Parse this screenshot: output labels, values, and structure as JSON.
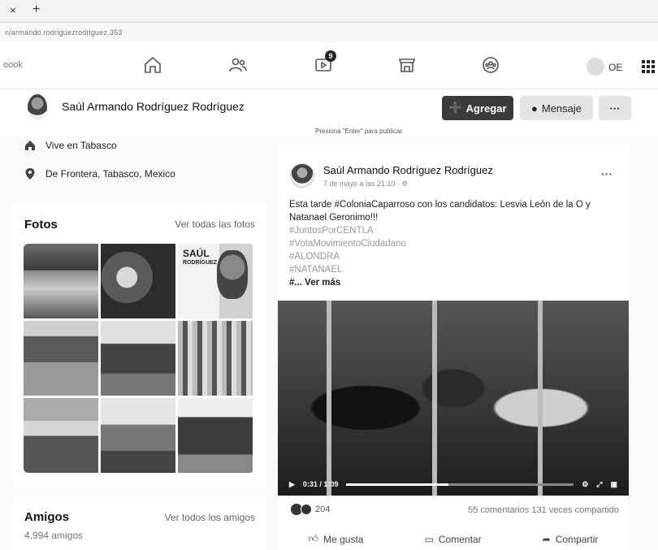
{
  "browser": {
    "close_glyph": "×",
    "new_tab_glyph": "+",
    "url": "n/armando.rodriguezrodriguez.353"
  },
  "nav": {
    "brand_partial": "oook",
    "notification_count": "9",
    "user_initials": "OE"
  },
  "profile": {
    "name": "Saúl Armando Rodríguez Rodríguez",
    "add_button": "Agregar",
    "message_button": "Mensaje",
    "more_button": "···",
    "hint": "Presiona \"Enter\" para publicar."
  },
  "intro": {
    "lives_in": "Vive en Tabasco",
    "from": "De Frontera, Tabasco, Mexico"
  },
  "photos": {
    "title": "Fotos",
    "see_all": "Ver todas las fotos",
    "tile_name": "SAÚL",
    "tile_surname": "RODRÍGUEZ"
  },
  "friends": {
    "title": "Amigos",
    "see_all": "Ver todos los amigos",
    "count": "4,994 amigos"
  },
  "post": {
    "author": "Saúl Armando Rodríguez Rodríguez",
    "date": "7 de mayo a las 21:10 · ",
    "more": "···",
    "text_intro": "Esta tarde #ColoniaCaparroso con los candidatos: Lesvia León de la O y Natanael Geronimo!!!",
    "tags": [
      "#JuntosPorCENTLA",
      "#VotaMovimientoCiudadano",
      "#ALONDRA",
      "#NATANAEL"
    ],
    "see_more": "#... Ver más",
    "video_time": "0:31 / 1:09",
    "video_progress": 0.45,
    "reactions": "204",
    "comments_shares": "55 comentarios  131 veces compartido",
    "like": "Me gusta",
    "comment": "Comentar",
    "share": "Compartir"
  }
}
